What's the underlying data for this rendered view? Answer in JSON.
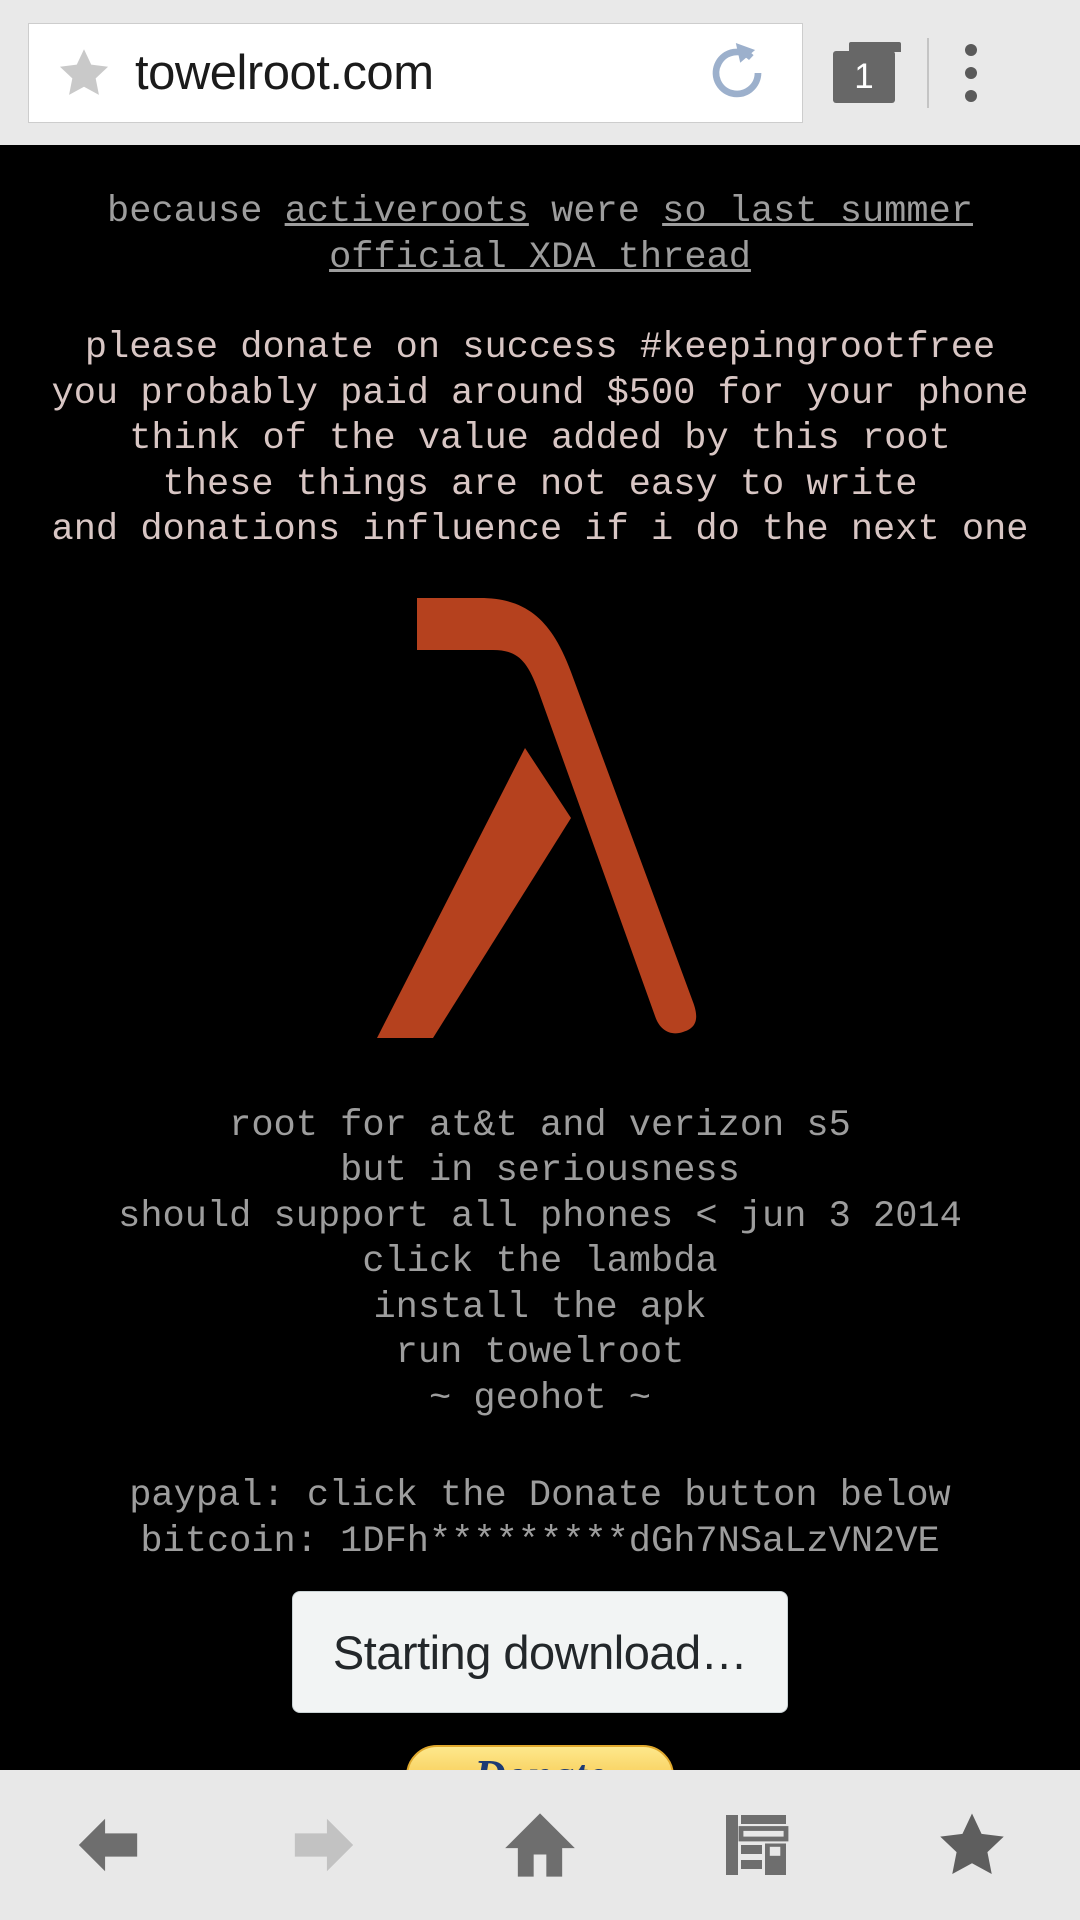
{
  "browser": {
    "url": "towelroot.com",
    "bookmark_icon": "star-icon",
    "reload_icon": "reload-icon",
    "tab_count": "1",
    "menu_icon": "overflow-menu-icon"
  },
  "page": {
    "intro": {
      "line1_prefix": "because ",
      "link_activeroots": "activeroots",
      "line1_middle": " were ",
      "link_so_last_summer": "so last summer",
      "link_xda_thread": "official XDA thread"
    },
    "donate": {
      "line1": "please donate on success #keepingrootfree",
      "line2": "you probably paid around $500 for your phone",
      "line3": "think of the value added by this root",
      "line4": "these things are not easy to write",
      "line5": "and donations influence if i do the next one"
    },
    "lambda": {
      "name": "lambda-logo",
      "color": "#b5411e"
    },
    "instructions": {
      "line1": "root for at&t and verizon s5",
      "line2": "but in seriousness",
      "line3": "should support all phones < jun 3 2014",
      "line4": "click the lambda",
      "line5": "install the apk",
      "line6": "run towelroot",
      "line7": "~ geohot ~"
    },
    "payment": {
      "paypal": "paypal: click the Donate button below",
      "bitcoin": "bitcoin: 1DFh*********dGh7NSaLzVN2VE"
    },
    "donate_button_label": "Donate"
  },
  "toast": {
    "message": "Starting download…"
  },
  "bottom_nav": {
    "back": "back-arrow-icon",
    "forward": "forward-arrow-icon",
    "home": "home-icon",
    "reader": "reader-icon",
    "bookmarks": "bookmark-star-icon"
  },
  "colors": {
    "page_background": "#000000",
    "chrome_background": "#e9e9e9",
    "text_gray": "#9d9d9d",
    "text_warm": "#d8c6c4",
    "lambda_rust": "#b5411e",
    "toast_background": "#f2f4f4"
  }
}
